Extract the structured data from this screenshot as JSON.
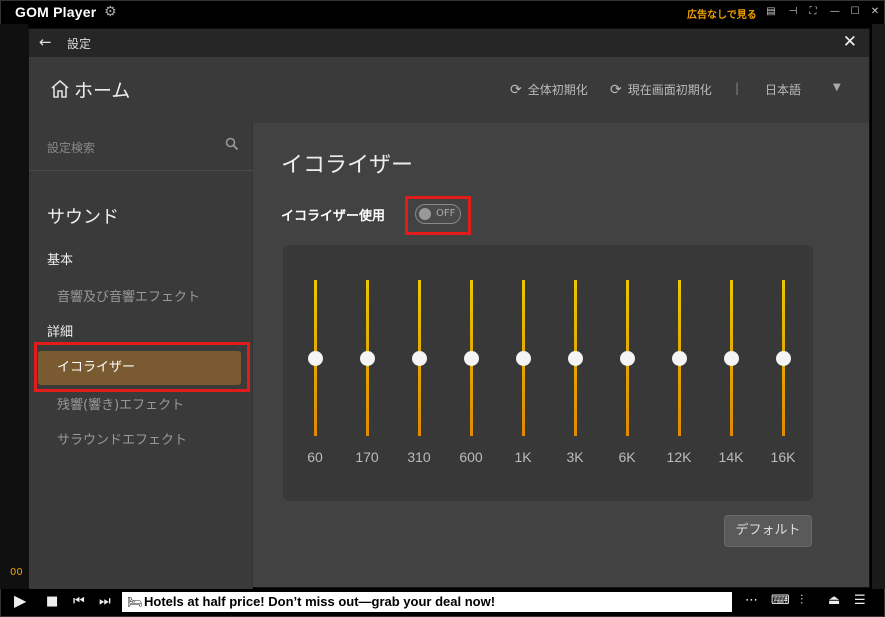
{
  "player": {
    "logo": "GOM Player",
    "ad_free_link": "広告なしで見る",
    "time": "00",
    "ad_text": "Hotels at half price! Don’t miss out—grab your deal now!"
  },
  "settings": {
    "window_title": "設定",
    "home_label": "ホーム",
    "reset_all_label": "全体初期化",
    "reset_current_label": "現在画面初期化",
    "separator": "|",
    "language": "日本語"
  },
  "sidebar": {
    "search_placeholder": "設定検索",
    "heading": "サウンド",
    "group_basic": "基本",
    "item_sound_effects": "音響及び音響エフェクト",
    "group_detail": "詳細",
    "item_equalizer": "イコライザー",
    "item_reverb": "残響(響き)エフェクト",
    "item_surround": "サラウンドエフェクト"
  },
  "main": {
    "title": "イコライザー",
    "use_label": "イコライザー使用",
    "toggle_state": "OFF",
    "default_button": "デフォルト",
    "bands": [
      {
        "freq": "60",
        "level": 0.5
      },
      {
        "freq": "170",
        "level": 0.5
      },
      {
        "freq": "310",
        "level": 0.5
      },
      {
        "freq": "600",
        "level": 0.5
      },
      {
        "freq": "1K",
        "level": 0.5
      },
      {
        "freq": "3K",
        "level": 0.5
      },
      {
        "freq": "6K",
        "level": 0.5
      },
      {
        "freq": "12K",
        "level": 0.5
      },
      {
        "freq": "14K",
        "level": 0.5
      },
      {
        "freq": "16K",
        "level": 0.5
      }
    ]
  },
  "colors": {
    "accent": "#e8a000",
    "selected_item": "#7a5a30",
    "highlight_box": "#e21b1b"
  }
}
